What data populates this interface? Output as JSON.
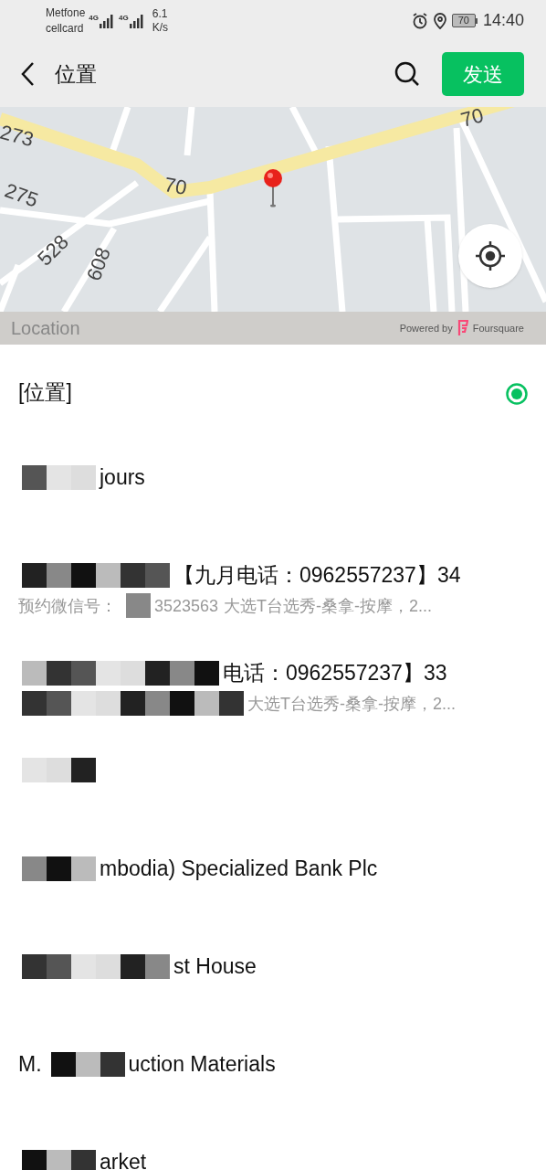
{
  "status_bar": {
    "carrier_1": "Metfone",
    "carrier_2": "cellcard",
    "signal_1_label": "4G",
    "signal_2_label": "4G",
    "speed_value": "6.1",
    "speed_unit": "K/s",
    "battery": "70",
    "time": "14:40"
  },
  "nav": {
    "title": "位置",
    "send_button": "发送"
  },
  "map": {
    "road_labels": [
      "273",
      "70",
      "275",
      "528",
      "608",
      "70"
    ],
    "footer_label": "Location",
    "powered_by": "Powered by",
    "provider": "Foursquare"
  },
  "places": [
    {
      "selected": true,
      "title": [
        {
          "kind": "text",
          "text": "[位置]"
        }
      ]
    },
    {
      "selected": false,
      "title": [
        {
          "kind": "mosaic"
        },
        {
          "kind": "text",
          "text": "jours"
        }
      ]
    },
    {
      "selected": false,
      "title": [
        {
          "kind": "mosaic"
        },
        {
          "kind": "text",
          "text": "【九月电话：0962557237】34"
        }
      ],
      "subtitle": [
        {
          "kind": "text",
          "text": "预约微信号："
        },
        {
          "kind": "mosaic"
        },
        {
          "kind": "text",
          "text": "3523563"
        },
        {
          "kind": "text",
          "text": "大选T台选秀-桑拿-按摩，2..."
        }
      ]
    },
    {
      "selected": false,
      "title": [
        {
          "kind": "mosaic"
        },
        {
          "kind": "text",
          "text": "电话：0962557237】33"
        }
      ],
      "subtitle": [
        {
          "kind": "mosaic"
        },
        {
          "kind": "text",
          "text": "大选T台选秀-桑拿-按摩，2..."
        }
      ]
    },
    {
      "selected": false,
      "title": [
        {
          "kind": "mosaic"
        }
      ]
    },
    {
      "selected": false,
      "title": [
        {
          "kind": "mosaic"
        },
        {
          "kind": "text",
          "text": "mbodia) Specialized Bank Plc"
        }
      ]
    },
    {
      "selected": false,
      "title": [
        {
          "kind": "mosaic"
        },
        {
          "kind": "text",
          "text": "st House"
        }
      ]
    },
    {
      "selected": false,
      "title": [
        {
          "kind": "text",
          "text": "M."
        },
        {
          "kind": "mosaic"
        },
        {
          "kind": "text",
          "text": "uction Materials"
        }
      ]
    },
    {
      "selected": false,
      "title": [
        {
          "kind": "mosaic"
        },
        {
          "kind": "text",
          "text": "arket"
        }
      ]
    }
  ]
}
